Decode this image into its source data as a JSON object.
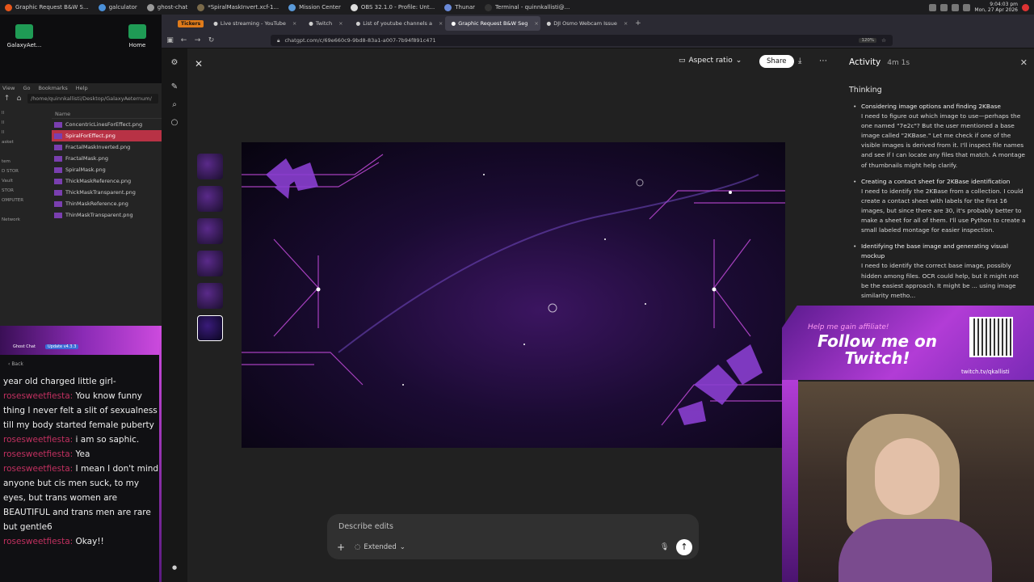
{
  "taskbar": {
    "apps": [
      {
        "label": "Graphic Request B&W S...",
        "color": "#e8561a"
      },
      {
        "label": "galculator",
        "color": "#4a90d9"
      },
      {
        "label": "ghost-chat",
        "color": "#9a9a9a"
      },
      {
        "label": "*SpiralMaskInvert.xcf-1...",
        "color": "#7a6a4a"
      },
      {
        "label": "Mission Center",
        "color": "#5a9ad9"
      },
      {
        "label": "OBS 32.1.0 - Profile: Unt...",
        "color": "#dddddd"
      },
      {
        "label": "Thunar",
        "color": "#6a8ad9"
      },
      {
        "label": "Terminal - quinnkallisti@...",
        "color": "#333333"
      }
    ],
    "date_line1": "9:04:03 pm",
    "date_line2": "Mon, 27 Apr 2026"
  },
  "desktop": {
    "icons": [
      {
        "label": "GalaxyAet..."
      },
      {
        "label": "Home"
      }
    ]
  },
  "file_manager": {
    "menu": [
      "View",
      "Go",
      "Bookmarks",
      "Help"
    ],
    "path": "/home/quinnkallisti/Desktop/GalaxyAeternum/",
    "column": "Name",
    "sidebar": [
      "ll",
      "ll",
      "ll",
      "asket",
      "",
      "tem",
      "D STOR",
      "Vault",
      "STOR",
      "OMPUTER",
      "",
      "Network"
    ],
    "files": [
      "ConcentricLinesForEffect.png",
      "SpiralForEffect.png",
      "FractalMaskInverted.png",
      "FractalMask.png",
      "SpiralMask.png",
      "ThickMaskReference.png",
      "ThickMaskTransparent.png",
      "ThinMaskReference.png",
      "ThinMaskTransparent.png"
    ],
    "selected_index": 1
  },
  "chat": {
    "title": "Ghost Chat",
    "update": "Update v4.3.3",
    "back": "Back",
    "messages": [
      {
        "user": "",
        "text": "year old charged little girl-"
      },
      {
        "user": "rosesweetfiesta:",
        "text": "You know funny thing I never felt a slit of sexualness till my body started female puberty"
      },
      {
        "user": "rosesweetfiesta:",
        "text": "i am so saphic."
      },
      {
        "user": "rosesweetfiesta:",
        "text": "Yea"
      },
      {
        "user": "rosesweetfiesta:",
        "text": "I mean I don't mind anyone but cis men suck, to my eyes, but trans women are BEAUTIFUL and trans men are rare but gentle6"
      },
      {
        "user": "rosesweetfiesta:",
        "text": "Okay!!"
      }
    ]
  },
  "browser": {
    "badge": "Tickers",
    "tabs": [
      {
        "label": "Live streaming - YouTube",
        "active": false
      },
      {
        "label": "Twitch",
        "active": false
      },
      {
        "label": "List of youtube channels a",
        "active": false
      },
      {
        "label": "Graphic Request B&W Seg",
        "active": true
      },
      {
        "label": "DJI Osmo Webcam Issue",
        "active": false
      }
    ],
    "url": "chatgpt.com/c/69e660c9-9bd8-83a1-a007-7b94f891c471",
    "zoom": "120%"
  },
  "editor": {
    "aspect_label": "Aspect ratio",
    "share_label": "Share",
    "composer_placeholder": "Describe edits",
    "mode_label": "Extended"
  },
  "activity": {
    "title": "Activity",
    "duration": "4m 1s",
    "section": "Thinking",
    "items": [
      {
        "heading": "Considering image options and finding 2KBase",
        "body": "I need to figure out which image to use—perhaps the one named \"7e2c\"? But the user mentioned a base image called \"2KBase.\" Let me check if one of the visible images is derived from it. I'll inspect file names and see if I can locate any files that match. A montage of thumbnails might help clarify."
      },
      {
        "heading": "Creating a contact sheet for 2KBase identification",
        "body": "I need to identify the 2KBase from a collection. I could create a contact sheet with labels for the first 16 images, but since there are 30, it's probably better to make a sheet for all of them. I'll use Python to create a small labeled montage for easier inspection."
      },
      {
        "heading": "Identifying the base image and generating visual mockup",
        "body": "I need to identify the correct base image, possibly hidden among files. OCR could help, but it might not be the easiest approach. It might be ... using image similarity metho..."
      }
    ]
  },
  "overlay": {
    "small": "Help me gain affiliate!",
    "big": "Follow me on Twitch!",
    "url": "twitch.tv/qkallisti"
  },
  "colors": {
    "accent_purple": "#b23cd6",
    "chat_user": "#c23060",
    "selection_red": "#b83245"
  }
}
